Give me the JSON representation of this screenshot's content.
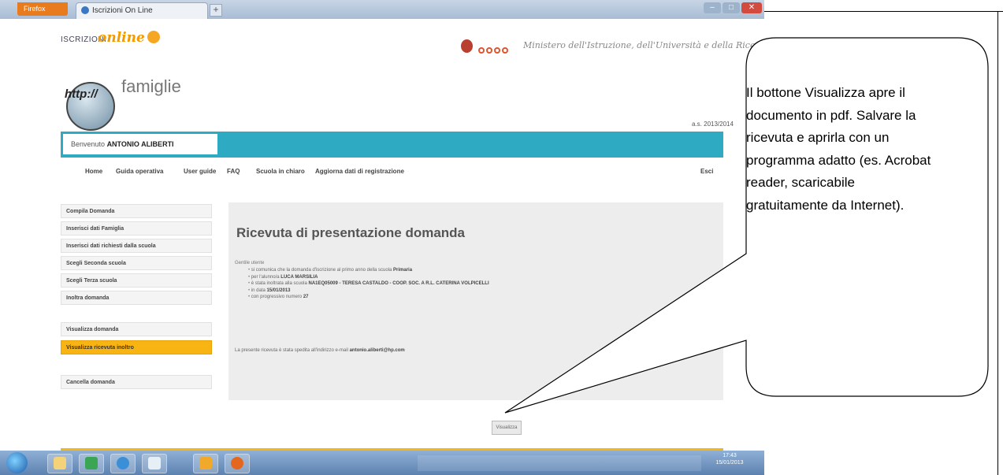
{
  "browser": {
    "app_button": "Firefox",
    "tab_title": "Iscrizioni On Line",
    "new_tab": "+"
  },
  "header": {
    "logo_prefix": "ISCRIZIONI",
    "logo_online": "online",
    "logo_famiglie": "famiglie",
    "logo_http": "http://",
    "ministry": "Ministero dell'Istruzione, dell'Università e della Ricerca",
    "school_year": "a.s. 2013/2014"
  },
  "welcome": {
    "label": "Benvenuto",
    "user_name": "ANTONIO ALIBERTI"
  },
  "nav": {
    "items": [
      "Home",
      "Guida operativa",
      "User guide",
      "FAQ",
      "Scuola in chiaro",
      "Aggiorna dati di registrazione"
    ],
    "logout": "Esci"
  },
  "sidebar": {
    "items": [
      "Compila Domanda",
      "Inserisci dati Famiglia",
      "Inserisci dati richiesti dalla scuola",
      "Scegli Seconda scuola",
      "Scegli Terza scuola",
      "Inoltra domanda",
      "Visualizza domanda",
      "Visualizza ricevuta inoltro",
      "Cancella domanda"
    ],
    "active_index": 7
  },
  "receipt": {
    "title": "Ricevuta di presentazione domanda",
    "intro": "Gentile utente",
    "line1_text": "si comunica che la domanda d'iscrizione al primo anno della scuola",
    "line1_value": "Primaria",
    "line2_text": "per l'alunno/a",
    "line2_value": "LUCA MARSILIA",
    "line3_text": "è stata inoltrata alla scuola",
    "line3_value": "NA1EQ05009 - TERESA CASTALDO - COOP. SOC. A R.L. CATERINA VOLPICELLI",
    "line4_text": "in data",
    "line4_value": "15/01/2013",
    "line5_text": "con progressivo numero",
    "line5_value": "27",
    "sent_text": "La presente ricevuta è stata spedita all'indirizzo e-mail",
    "sent_email": "antonio.aliberti@hp.com",
    "view_button": "Visualizza"
  },
  "taskbar": {
    "clock_time": "17:43",
    "clock_date": "15/01/2013"
  },
  "callout": {
    "text": "Il bottone Visualizza apre il documento in pdf. Salvare la ricevuta e aprirla con un programma adatto (es. Acrobat reader, scaricabile gratuitamente da Internet)."
  }
}
